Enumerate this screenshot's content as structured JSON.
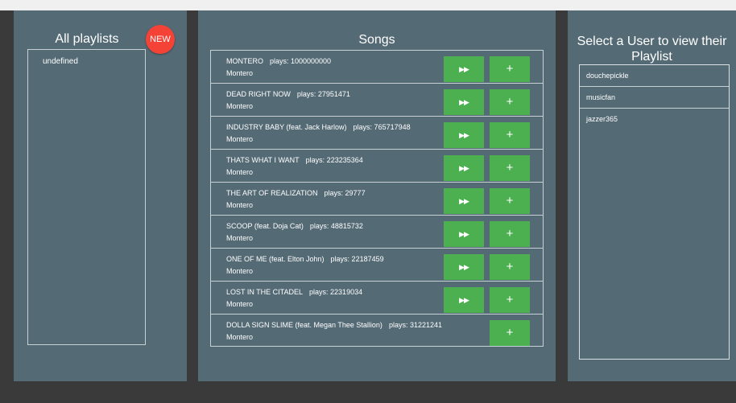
{
  "playlists_panel": {
    "title": "All playlists",
    "new_label": "NEW",
    "items": [
      "undefined"
    ]
  },
  "songs_panel": {
    "title": "Songs",
    "play_icon": "fast-forward-icon",
    "add_icon": "plus-icon",
    "songs": [
      {
        "title": "MONTERO",
        "plays": "plays: 1000000000",
        "artist": "Montero"
      },
      {
        "title": "DEAD RIGHT NOW",
        "plays": "plays: 27951471",
        "artist": "Montero"
      },
      {
        "title": "INDUSTRY BABY (feat. Jack Harlow)",
        "plays": "plays: 765717948",
        "artist": "Montero"
      },
      {
        "title": "THATS WHAT I WANT",
        "plays": "plays: 223235364",
        "artist": "Montero"
      },
      {
        "title": "THE ART OF REALIZATION",
        "plays": "plays: 29777",
        "artist": "Montero"
      },
      {
        "title": "SCOOP (feat. Doja Cat)",
        "plays": "plays: 48815732",
        "artist": "Montero"
      },
      {
        "title": "ONE OF ME (feat. Elton John)",
        "plays": "plays: 22187459",
        "artist": "Montero"
      },
      {
        "title": "LOST IN THE CITADEL",
        "plays": "plays: 22319034",
        "artist": "Montero"
      },
      {
        "title": "DOLLA SIGN SLIME (feat. Megan Thee Stallion)",
        "plays": "plays: 31221241",
        "artist": "Montero"
      }
    ]
  },
  "users_panel": {
    "title": "Select a User to view their Playlist",
    "users": [
      "douchepickle",
      "musicfan",
      "jazzer365"
    ]
  },
  "colors": {
    "background": "#3a3a3a",
    "panel": "#546a75",
    "button_green": "#4caf50",
    "new_red": "#f44336"
  }
}
